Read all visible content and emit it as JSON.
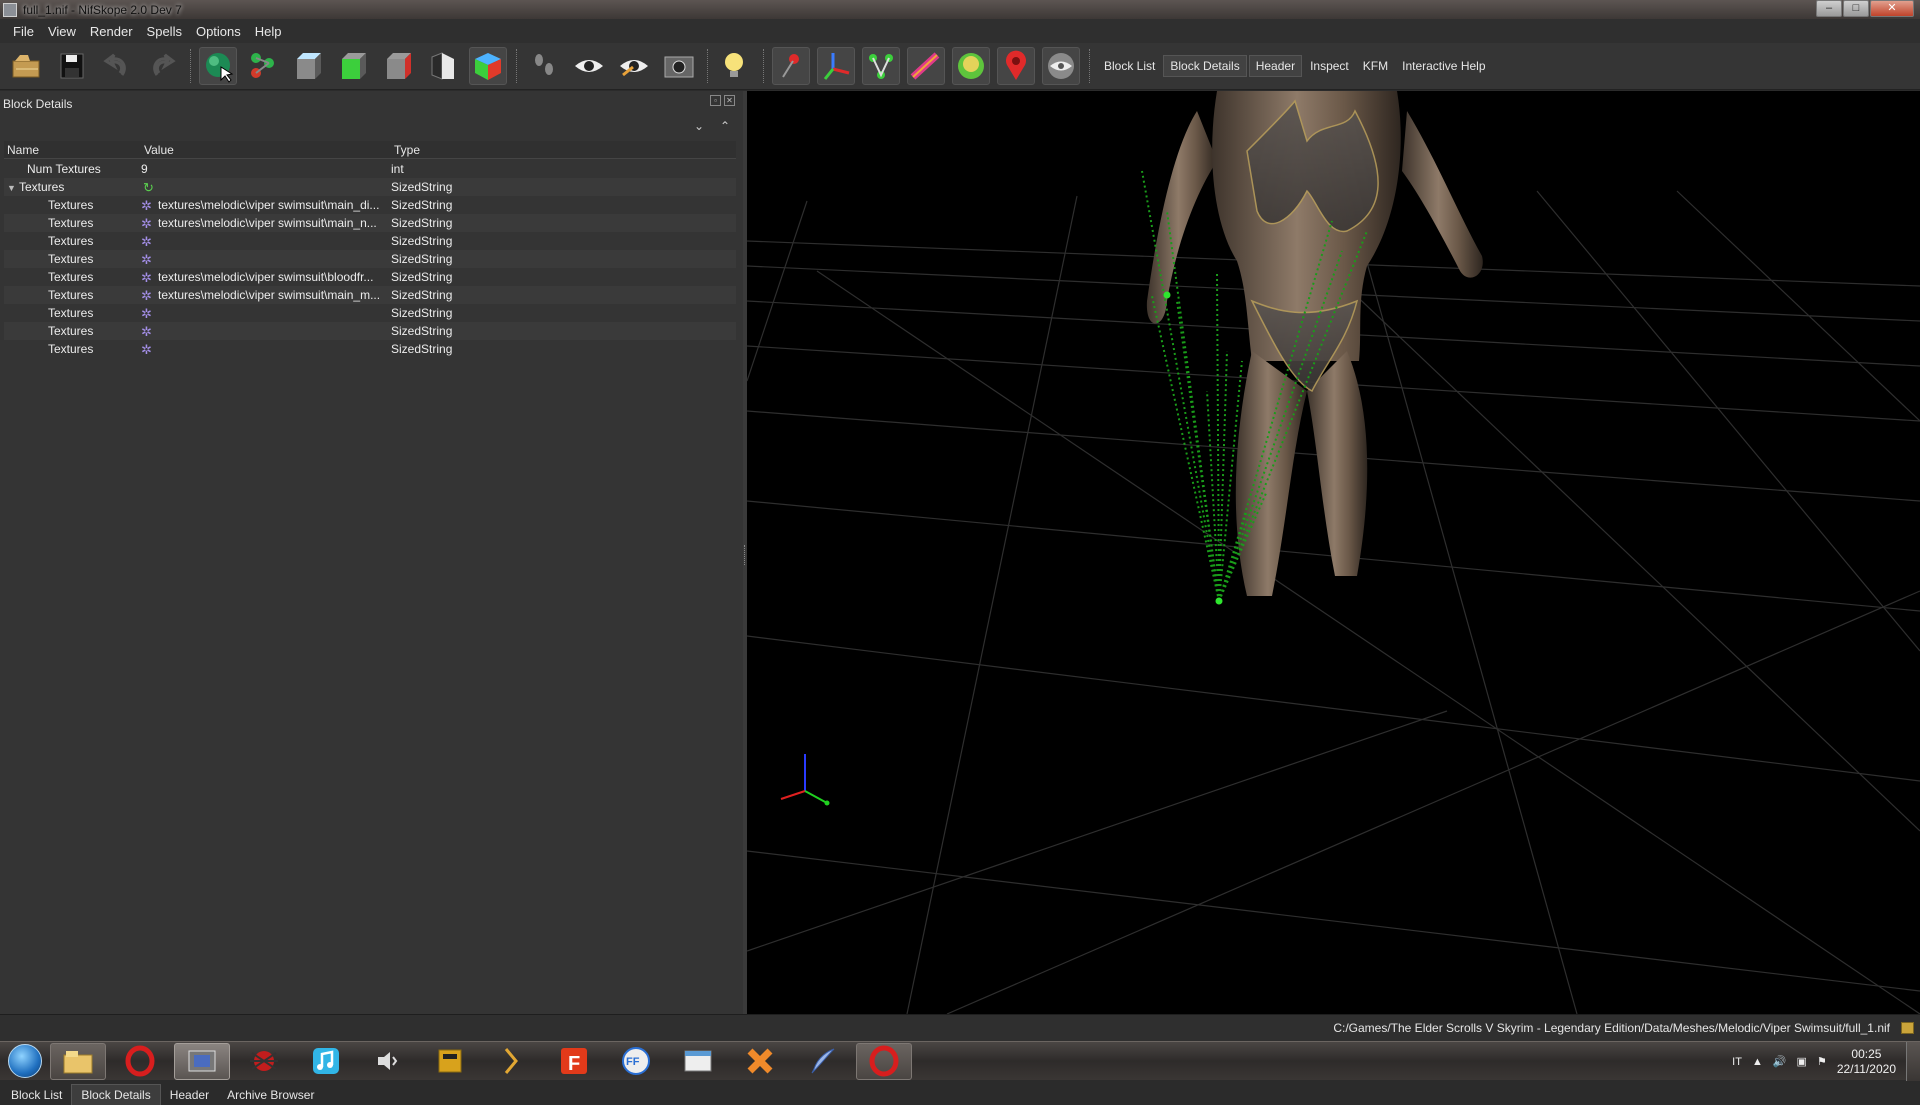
{
  "window": {
    "title": "full_1.nif - NifSkope 2.0 Dev 7",
    "controls": [
      "–",
      "□",
      "✕"
    ]
  },
  "menu": [
    "File",
    "View",
    "Render",
    "Spells",
    "Options",
    "Help"
  ],
  "toolbar": {
    "icons": [
      "open-icon",
      "save-icon",
      "undo-icon",
      "redo-icon",
      "select-icon",
      "select-bones-icon",
      "view-top-icon",
      "view-front-icon",
      "view-side-icon",
      "view-walk-icon",
      "view-user-icon",
      "footsteps-icon",
      "show-eye-icon",
      "show-hidden-icon",
      "screenshot-icon",
      "light-icon",
      "pin-icon",
      "axes-icon",
      "nodes-icon",
      "constraints-icon",
      "markers-icon",
      "hide-markers-icon",
      "visibility-icon"
    ],
    "tabs": [
      "Block List",
      "Block Details",
      "Header",
      "Inspect",
      "KFM",
      "Interactive Help"
    ],
    "active_tab": "Block Details"
  },
  "dock": {
    "title": "Block Details",
    "columns": [
      "Name",
      "Value",
      "Type"
    ],
    "rows": [
      {
        "name": "Num Textures",
        "value": "9",
        "type": "int",
        "level": 1,
        "icon": ""
      },
      {
        "name": "Textures",
        "value": "",
        "type": "SizedString",
        "level": 0,
        "icon": "refresh",
        "expanded": true
      },
      {
        "name": "Textures",
        "value": "textures\\melodic\\viper swimsuit\\main_di...",
        "type": "SizedString",
        "level": 2,
        "icon": "gear"
      },
      {
        "name": "Textures",
        "value": "textures\\melodic\\viper swimsuit\\main_n...",
        "type": "SizedString",
        "level": 2,
        "icon": "gear"
      },
      {
        "name": "Textures",
        "value": "",
        "type": "SizedString",
        "level": 2,
        "icon": "gear"
      },
      {
        "name": "Textures",
        "value": "",
        "type": "SizedString",
        "level": 2,
        "icon": "gear"
      },
      {
        "name": "Textures",
        "value": "textures\\melodic\\viper swimsuit\\bloodfr...",
        "type": "SizedString",
        "level": 2,
        "icon": "gear"
      },
      {
        "name": "Textures",
        "value": "textures\\melodic\\viper swimsuit\\main_m...",
        "type": "SizedString",
        "level": 2,
        "icon": "gear"
      },
      {
        "name": "Textures",
        "value": "",
        "type": "SizedString",
        "level": 2,
        "icon": "gear"
      },
      {
        "name": "Textures",
        "value": "",
        "type": "SizedString",
        "level": 2,
        "icon": "gear"
      },
      {
        "name": "Textures",
        "value": "",
        "type": "SizedString",
        "level": 2,
        "icon": "gear"
      }
    ],
    "bottom_tabs": [
      "Block List",
      "Block Details",
      "Header",
      "Archive Browser"
    ],
    "active_bottom_tab": "Block Details"
  },
  "statusbar": {
    "path": "C:/Games/The Elder Scrolls V Skyrim - Legendary Edition/Data/Meshes/Melodic/Viper Swimsuit/full_1.nif"
  },
  "taskbar": {
    "apps": [
      "explorer-icon",
      "opera-icon",
      "media-center-icon",
      "spider-icon",
      "music-icon",
      "speaker-icon",
      "calculator-icon",
      "arrow-icon",
      "f-app-icon",
      "ffdec-icon",
      "window-icon",
      "orange-x-icon",
      "feather-icon",
      "opera-icon"
    ],
    "tray": {
      "language": "IT",
      "time": "00:25",
      "date": "22/11/2020"
    }
  },
  "colors": {
    "accent_green": "#1a9c1a",
    "grid": "#3a3a3a",
    "panel_bg": "#343434"
  }
}
